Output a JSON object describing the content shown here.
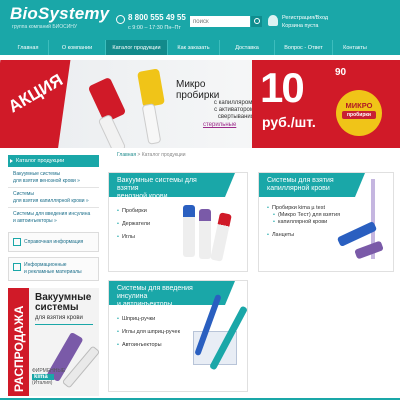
{
  "header": {
    "logo": "BioSystemy",
    "logo_sub": "группа компаний БИОСИНУ",
    "phone": "8 800 555 49 55",
    "hours": "с 9:00 – 17:30 Пн–Пт",
    "search_placeholder": "поиск",
    "login": "Регистрация/Вход",
    "cart": "Корзина пуста"
  },
  "nav": {
    "items": [
      {
        "label": "Главная"
      },
      {
        "label": "О компании"
      },
      {
        "label": "Каталог продукции"
      },
      {
        "label": "Как заказать"
      },
      {
        "label": "Доставка"
      },
      {
        "label": "Вопрос - Ответ"
      },
      {
        "label": "Контакты"
      }
    ]
  },
  "banner": {
    "tag": "АКЦИЯ",
    "title_1": "Микро",
    "title_2": "пробирки",
    "desc_1": "с капилляром,",
    "desc_2": "с активатором",
    "desc_3": "свертывания",
    "steril": "стерильные",
    "price": "10",
    "price_cents": "90",
    "price_unit": "руб./шт.",
    "badge_1": "МИКРО",
    "badge_2": "пробирки"
  },
  "sidebar": {
    "heading": "Каталог продукции",
    "links": [
      {
        "l1": "Вакуумные системы",
        "l2": "для взятия венозной крови »"
      },
      {
        "l1": "Системы",
        "l2": "для взятия капиллярной крови »"
      },
      {
        "l1": "Системы для введения инсулина",
        "l2": "и автоинъекторы »"
      }
    ],
    "info": "Справочная информация",
    "materials_1": "Информационные",
    "materials_2": "и рекламные материалы"
  },
  "sale": {
    "strip": "РАСПРОДАЖА",
    "title_1": "Вакуумные",
    "title_2": "системы",
    "sub": "для взятия крови",
    "brand_top": "ФИРМЕННЫЕ",
    "brand": "kima",
    "brand_country": "(Италия)"
  },
  "breadcrumb": {
    "home": "Главная",
    "sep": " > ",
    "current": "Каталог продукции"
  },
  "cards": [
    {
      "title_1": "Вакуумные системы для взятия",
      "title_2": "венозной крови",
      "items": [
        "Пробирки",
        "Держатели",
        "Иглы"
      ]
    },
    {
      "title_1": "Системы для взятия",
      "title_2": "капиллярной крови",
      "items": [
        "Пробирки kima µ test",
        "(Микро Тест) для взятия",
        "капиллярной крови",
        "Ланцеты"
      ]
    },
    {
      "title_1": "Системы для введения инсулина",
      "title_2": "и автоинъекторы",
      "items": [
        "Шприц-ручки",
        "Иглы для шприц-ручек",
        "Автоинъекторы"
      ]
    }
  ],
  "colors": {
    "accent": "#1aa7a8",
    "promo": "#d01a28",
    "badge": "#f0c418"
  }
}
